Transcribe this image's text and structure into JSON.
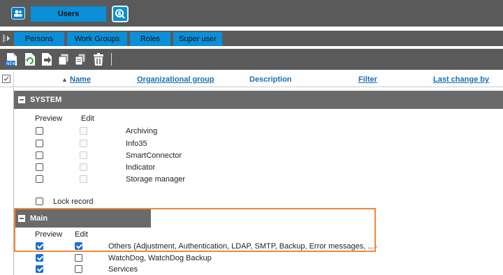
{
  "app": {
    "tab_label": "Users",
    "app_icon": "users-app-icon",
    "refresh_icon": "search-person-icon"
  },
  "tabs": [
    {
      "label": "Persons"
    },
    {
      "label": "Work Groups"
    },
    {
      "label": "Roles"
    },
    {
      "label": "Super user"
    }
  ],
  "toolbar": {
    "icons": [
      "new-icon",
      "reload-icon",
      "export-icon",
      "copy-icon",
      "stack-icon",
      "delete-icon"
    ]
  },
  "columns": {
    "name": "Name",
    "org_group": "Organizational group",
    "description": "Description",
    "filter": "Filter",
    "last_change": "Last change by",
    "sort_indicator": "▲"
  },
  "sections": [
    {
      "title": "SYSTEM",
      "preview_label": "Preview",
      "edit_label": "Edit",
      "rows": [
        {
          "label": "Archiving",
          "preview": false,
          "edit": false
        },
        {
          "label": "Info35",
          "preview": false,
          "edit": false
        },
        {
          "label": "SmartConnector",
          "preview": false,
          "edit": false
        },
        {
          "label": "Indicator",
          "preview": false,
          "edit": false
        },
        {
          "label": "Storage manager",
          "preview": false,
          "edit": false
        }
      ],
      "lock_record": "Lock record"
    },
    {
      "title": "Main",
      "preview_label": "Preview",
      "edit_label": "Edit",
      "rows": [
        {
          "label": "Others (Adjustment, Authentication, LDAP, SMTP, Backup, Error messages, ...)",
          "preview": true,
          "edit": true
        },
        {
          "label": "WatchDog, WatchDog Backup",
          "preview": true,
          "edit": false
        },
        {
          "label": "Services",
          "preview": true,
          "edit": false
        }
      ]
    }
  ],
  "colors": {
    "accent": "#0a8fd8",
    "bar": "#5a5a5a",
    "highlight": "#f0883a",
    "link": "#1a6fb5"
  }
}
